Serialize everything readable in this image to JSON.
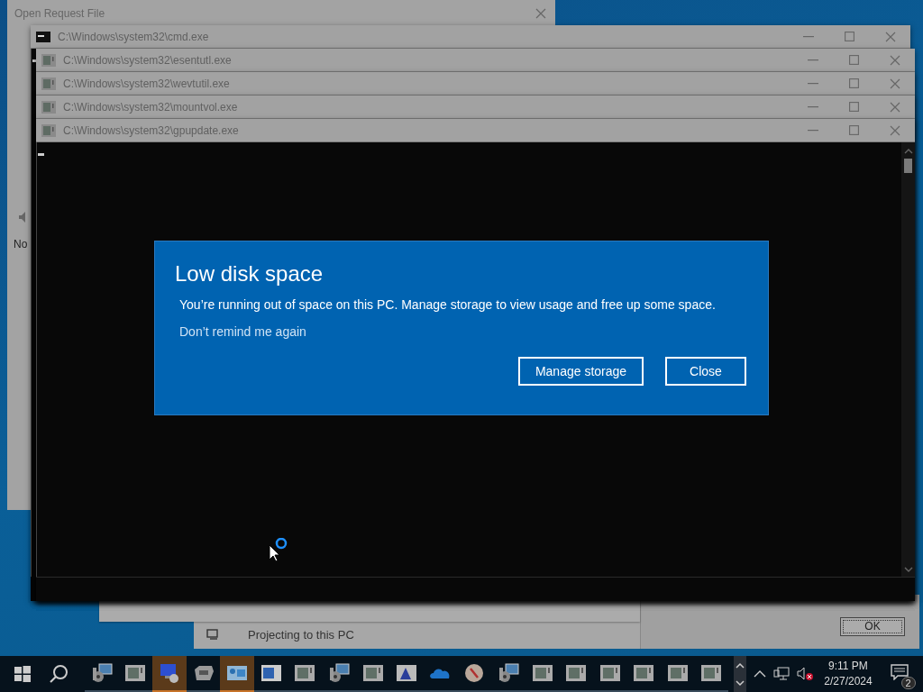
{
  "back_window": {
    "title": "Open Request File",
    "text": "No"
  },
  "console_windows": [
    {
      "title": "C:\\Windows\\system32\\cmd.exe",
      "kind": "cmd"
    },
    {
      "title": "C:\\Windows\\system32\\esentutl.exe",
      "kind": "app"
    },
    {
      "title": "C:\\Windows\\system32\\wevtutil.exe",
      "kind": "app"
    },
    {
      "title": "C:\\Windows\\system32\\mountvol.exe",
      "kind": "app"
    },
    {
      "title": "C:\\Windows\\system32\\gpupdate.exe",
      "kind": "app"
    }
  ],
  "dialog": {
    "title": "Low disk space",
    "message": "You’re running out of space on this PC. Manage storage to view usage and free up some space.",
    "link": "Don’t remind me again",
    "buttons": [
      "Manage storage",
      "Close"
    ]
  },
  "lower_window": {
    "label": "Projecting to this PC"
  },
  "ok_button": "OK",
  "taskbar": {
    "apps": [
      {
        "kind": "installer",
        "active": false
      },
      {
        "kind": "console",
        "active": false
      },
      {
        "kind": "computer",
        "active": true
      },
      {
        "kind": "drive",
        "active": false
      },
      {
        "kind": "network",
        "active": true
      },
      {
        "kind": "panel",
        "active": false
      },
      {
        "kind": "console",
        "active": false
      },
      {
        "kind": "installer",
        "active": false
      },
      {
        "kind": "console",
        "active": false
      },
      {
        "kind": "picture",
        "active": false
      },
      {
        "kind": "cloud",
        "active": false
      },
      {
        "kind": "gauge",
        "active": false
      },
      {
        "kind": "installer",
        "active": false
      },
      {
        "kind": "console",
        "active": false
      },
      {
        "kind": "console",
        "active": false
      },
      {
        "kind": "console",
        "active": false
      },
      {
        "kind": "console",
        "active": false
      },
      {
        "kind": "console",
        "active": false
      },
      {
        "kind": "console",
        "active": false
      }
    ],
    "time": "9:11 PM",
    "date": "2/27/2024",
    "notification_count": "2"
  }
}
